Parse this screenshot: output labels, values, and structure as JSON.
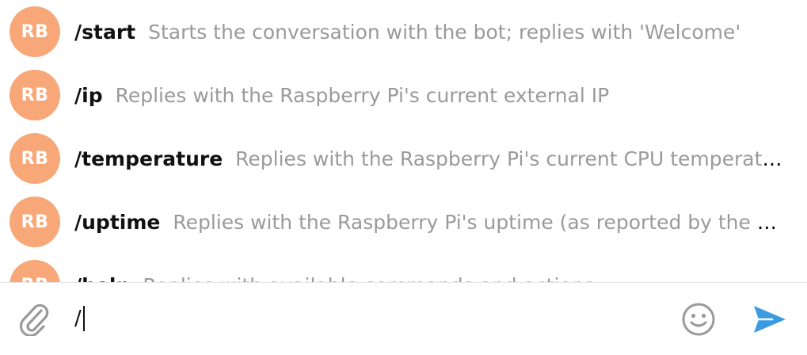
{
  "bot": {
    "avatar_initials": "RB",
    "avatar_color": "#f8a878"
  },
  "commands": [
    {
      "name": "/start",
      "description": "Starts the conversation with the bot; replies with 'Welcome'"
    },
    {
      "name": "/ip",
      "description": "Replies with the Raspberry Pi's current external IP"
    },
    {
      "name": "/temperature",
      "description": "Replies with the Raspberry Pi's current CPU temperature ..."
    },
    {
      "name": "/uptime",
      "description": "Replies with the Raspberry Pi's uptime (as reported by the upti..."
    },
    {
      "name": "/help",
      "description": "Replies with available commands and actions"
    }
  ],
  "composer": {
    "input_value": "/",
    "accent_color": "#3a9be0",
    "icons": {
      "attach": "paperclip-icon",
      "emoji": "smiley-icon",
      "send": "send-arrow-icon"
    }
  }
}
